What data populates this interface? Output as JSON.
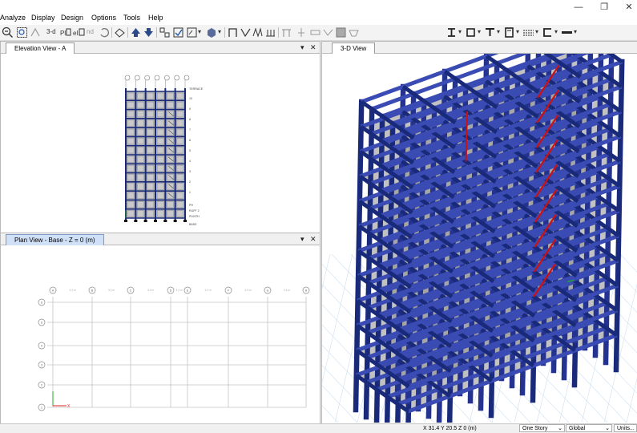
{
  "menu": [
    "Analyze",
    "Display",
    "Design",
    "Options",
    "Tools",
    "Help"
  ],
  "toolbar": {
    "view_3d": "3-d",
    "plan": "Plan",
    "elev": "Elev",
    "nd": "nd"
  },
  "panels": {
    "elevation_title": "Elevation View - A",
    "plan_title": "Plan View - Base - Z = 0 (m)",
    "view3d_title": "3-D View"
  },
  "elevation": {
    "story_labels": [
      "TERRACE",
      "10",
      "9",
      "8",
      "7",
      "6",
      "5",
      "4",
      "3",
      "2",
      "1",
      "PH",
      "RUFF 2",
      "PLINTH",
      "BASE"
    ]
  },
  "plan": {
    "grid_x": [
      "A",
      "B",
      "C",
      "D",
      "E",
      "F",
      "G",
      "H"
    ],
    "grid_y": [
      "6",
      "5",
      "4",
      "3",
      "2",
      "1"
    ],
    "spacing_labels": [
      "3.3 m",
      "3.3 m",
      "3.3 m",
      "3.3 m",
      "3.3 m",
      "3.3 m",
      "3.3 m"
    ]
  },
  "status": {
    "coords": "X 31.4  Y 20.5  Z 0 (m)",
    "story": "One Story",
    "system": "Global",
    "units": "Units..."
  },
  "colors": {
    "frame": "#1a2a7a",
    "frame_light": "#3a4bb3",
    "slab": "#9e9e9e",
    "brace": "#cc1111"
  }
}
